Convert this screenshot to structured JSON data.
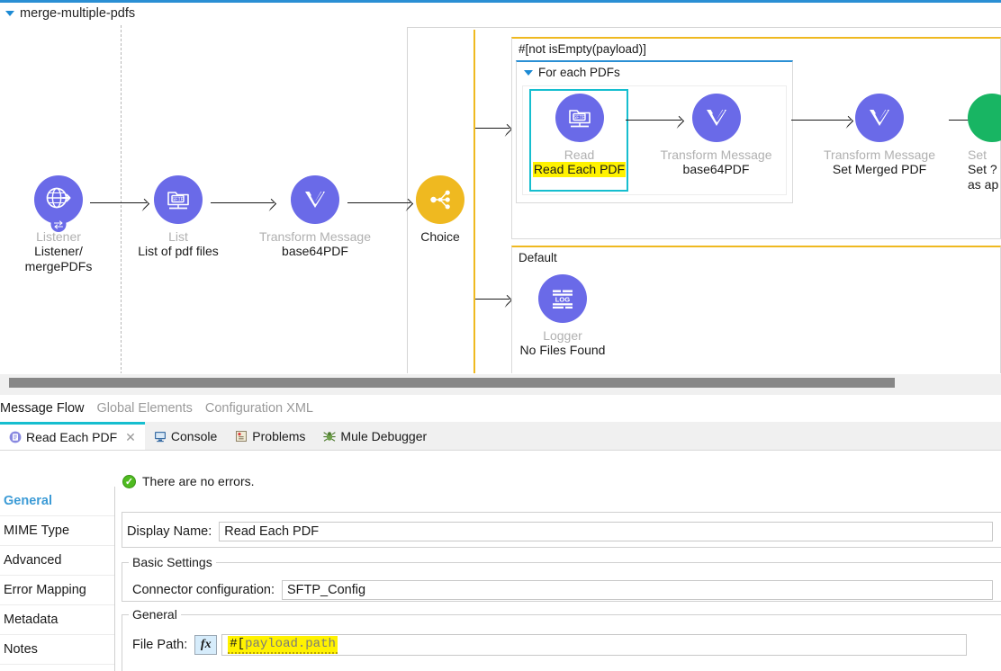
{
  "window": {
    "accent_color": "#2A8FD4"
  },
  "canvas": {
    "flow_name": "merge-multiple-pdfs",
    "nodes": [
      {
        "id": "listener",
        "type": "Listener",
        "label": "Listener/\nmergePDFs",
        "icon": "http-listener-icon",
        "color": "#6A6AE8"
      },
      {
        "id": "list",
        "type": "List",
        "label": "List of pdf files",
        "icon": "sftp-icon",
        "color": "#6A6AE8"
      },
      {
        "id": "transform1",
        "type": "Transform Message",
        "label": "base64PDF",
        "icon": "transform-message-icon",
        "color": "#6A6AE8"
      },
      {
        "id": "choice",
        "type": "Choice",
        "label": "",
        "icon": "choice-icon",
        "color": "#EFB920"
      },
      {
        "id": "read-each-pdf",
        "type": "Read",
        "label": "Read Each PDF",
        "icon": "sftp-icon",
        "color": "#6A6AE8"
      },
      {
        "id": "transform2",
        "type": "Transform Message",
        "label": "base64PDF",
        "icon": "transform-message-icon",
        "color": "#6A6AE8"
      },
      {
        "id": "transform3",
        "type": "Transform Message",
        "label": "Set Merged PDF",
        "icon": "transform-message-icon",
        "color": "#6A6AE8"
      },
      {
        "id": "set-payload",
        "type": "Set",
        "label": "Set ?\nas ap",
        "icon": "set-payload-icon",
        "color": "#18B563"
      },
      {
        "id": "logger",
        "type": "Logger",
        "label": "No Files Found",
        "icon": "logger-icon",
        "color": "#6A6AE8"
      }
    ],
    "when_branch_title": "#[not isEmpty(payload)]",
    "default_branch_title": "Default",
    "scope_title": "For each PDFs",
    "selection_color": "#16BECF",
    "highlight_color": "#FFF200"
  },
  "editor_tabs": [
    {
      "label": "Message Flow",
      "active": true
    },
    {
      "label": "Global Elements",
      "active": false
    },
    {
      "label": "Configuration XML",
      "active": false
    }
  ],
  "view_tabs": [
    {
      "label": "Read Each PDF",
      "icon": "properties-icon",
      "active": true,
      "closable": true
    },
    {
      "label": "Console",
      "icon": "console-icon",
      "active": false,
      "closable": false
    },
    {
      "label": "Problems",
      "icon": "problems-icon",
      "active": false,
      "closable": false
    },
    {
      "label": "Mule Debugger",
      "icon": "debugger-icon",
      "active": false,
      "closable": false
    }
  ],
  "properties": {
    "status_text": "There are no errors.",
    "status_icon": "success-check-icon",
    "side_items": [
      {
        "label": "General",
        "active": true
      },
      {
        "label": "MIME Type",
        "active": false
      },
      {
        "label": "Advanced",
        "active": false
      },
      {
        "label": "Error Mapping",
        "active": false
      },
      {
        "label": "Metadata",
        "active": false
      },
      {
        "label": "Notes",
        "active": false
      }
    ],
    "display_name_label": "Display Name:",
    "display_name_value": "Read Each PDF",
    "basic_settings_legend": "Basic Settings",
    "connector_config_label": "Connector configuration:",
    "connector_config_value": "SFTP_Config",
    "general_legend": "General",
    "file_path_label": "File Path:",
    "file_path_fx": "fx",
    "file_path_prefix": "#[",
    "file_path_value": "payload.path"
  }
}
